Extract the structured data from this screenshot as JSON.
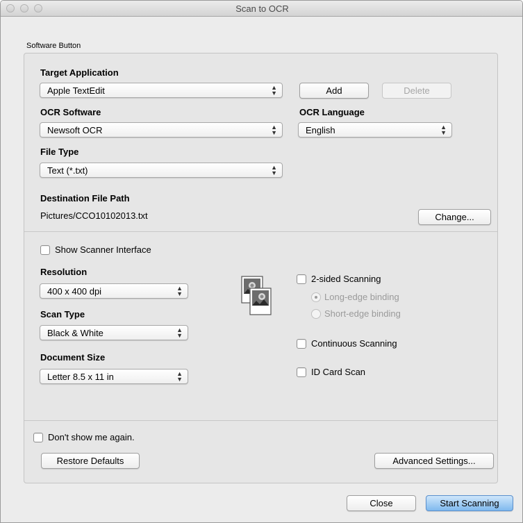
{
  "window": {
    "title": "Scan to OCR"
  },
  "group": {
    "label": "Software Button"
  },
  "target_application": {
    "label": "Target Application",
    "value": "Apple TextEdit"
  },
  "buttons": {
    "add": "Add",
    "delete": "Delete",
    "change": "Change...",
    "restore_defaults": "Restore Defaults",
    "advanced_settings": "Advanced Settings...",
    "close": "Close",
    "start_scanning": "Start Scanning"
  },
  "ocr_software": {
    "label": "OCR Software",
    "value": "Newsoft OCR"
  },
  "ocr_language": {
    "label": "OCR Language",
    "value": "English"
  },
  "file_type": {
    "label": "File Type",
    "value": "Text (*.txt)"
  },
  "destination": {
    "label": "Destination File Path",
    "value": "Pictures/CCO10102013.txt"
  },
  "show_scanner_interface": {
    "label": "Show Scanner Interface",
    "checked": false
  },
  "resolution": {
    "label": "Resolution",
    "value": "400 x 400 dpi"
  },
  "scan_type": {
    "label": "Scan Type",
    "value": "Black & White"
  },
  "document_size": {
    "label": "Document Size",
    "value": "Letter 8.5 x 11 in"
  },
  "two_sided": {
    "label": "2-sided Scanning",
    "checked": false
  },
  "binding": {
    "long_edge": {
      "label": "Long-edge binding",
      "selected": true,
      "enabled": false
    },
    "short_edge": {
      "label": "Short-edge binding",
      "selected": false,
      "enabled": false
    }
  },
  "continuous_scanning": {
    "label": "Continuous Scanning",
    "checked": false
  },
  "id_card_scan": {
    "label": "ID Card Scan",
    "checked": false
  },
  "dont_show_again": {
    "label": "Don't show me again.",
    "checked": false
  },
  "icons": [
    "duplex-scan-icon"
  ],
  "colors": {
    "default_button": "#7fb9ee",
    "disabled_text": "#9a9a9a"
  }
}
